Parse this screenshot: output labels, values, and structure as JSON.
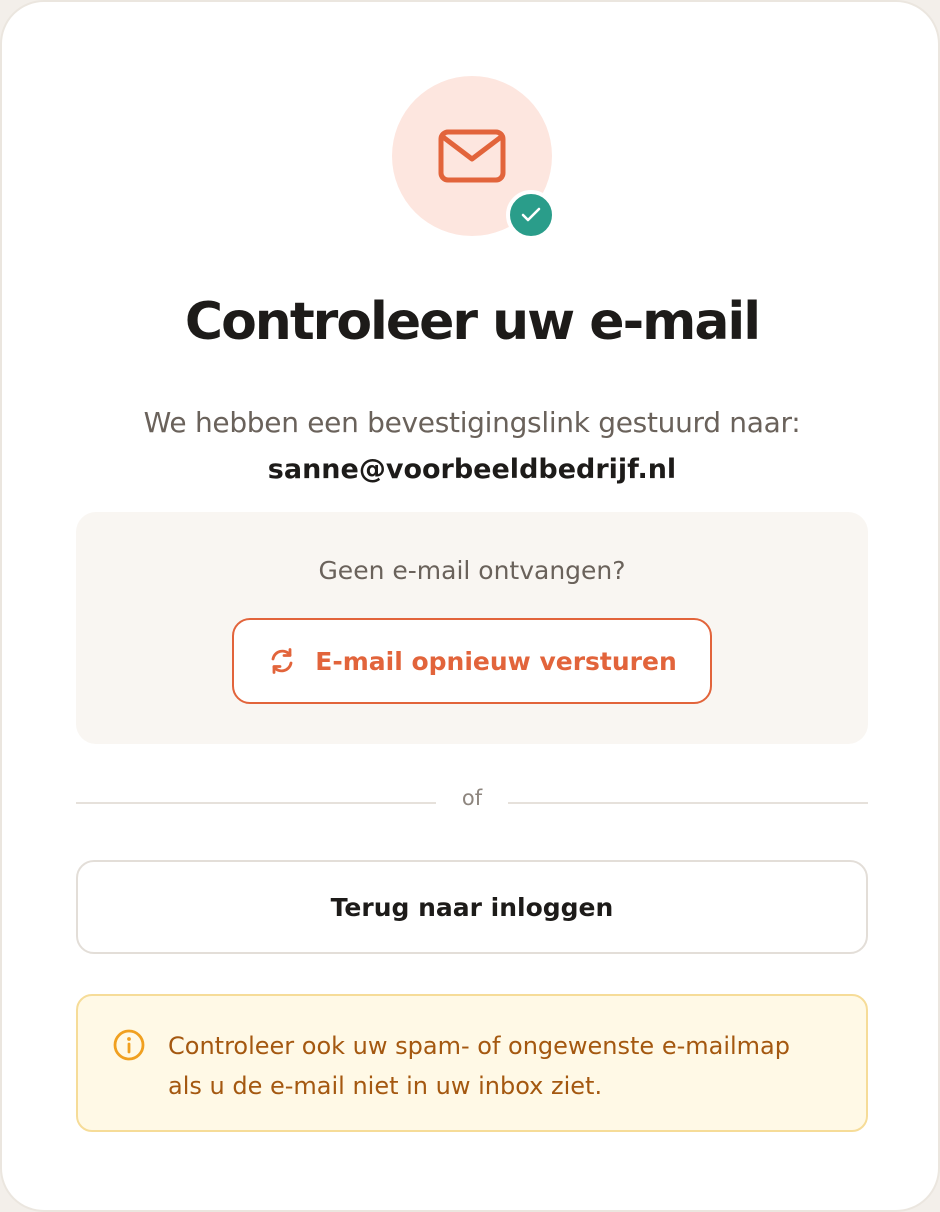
{
  "header": {
    "icon": "envelope-icon",
    "badge_icon": "check-icon",
    "title": "Controleer uw e-mail",
    "subtitle": "We hebben een bevestigingslink gestuurd naar:",
    "email": "sanne@voorbeeldbedrijf.nl"
  },
  "resend": {
    "question": "Geen e-mail ontvangen?",
    "button_label": "E-mail opnieuw versturen",
    "button_icon": "refresh-icon"
  },
  "divider": {
    "label": "of"
  },
  "back": {
    "button_label": "Terug naar inloggen"
  },
  "notice": {
    "icon": "info-icon",
    "text": "Controleer ook uw spam- of ongewenste e-mailmap als u de e-mail niet in uw inbox ziet."
  },
  "colors": {
    "accent": "#e2643b",
    "success": "#2a9d8a",
    "icon_bg": "#fde6df",
    "warning_text": "#a45810",
    "warning_bg": "#fff9e6"
  }
}
